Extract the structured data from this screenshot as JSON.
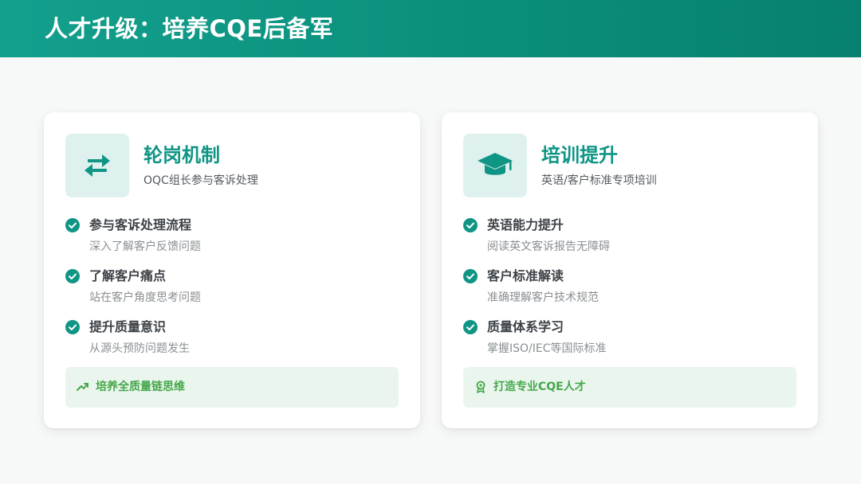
{
  "header": {
    "title": "人才升级：培养CQE后备军"
  },
  "colors": {
    "primary": "#0f9584",
    "icon_bg": "#dff1ee",
    "footer_bg": "#eaf6ed",
    "footer_text": "#45a74b"
  },
  "cards": [
    {
      "icon": "swap-arrows-icon",
      "title": "轮岗机制",
      "subtitle": "OQC组长参与客诉处理",
      "items": [
        {
          "title": "参与客诉处理流程",
          "desc": "深入了解客户反馈问题"
        },
        {
          "title": "了解客户痛点",
          "desc": "站在客户角度思考问题"
        },
        {
          "title": "提升质量意识",
          "desc": "从源头预防问题发生"
        }
      ],
      "footer": {
        "icon": "trending-up-icon",
        "text": "培养全质量链思维"
      }
    },
    {
      "icon": "graduation-cap-icon",
      "title": "培训提升",
      "subtitle": "英语/客户标准专项培训",
      "items": [
        {
          "title": "英语能力提升",
          "desc": "阅读英文客诉报告无障碍"
        },
        {
          "title": "客户标准解读",
          "desc": "准确理解客户技术规范"
        },
        {
          "title": "质量体系学习",
          "desc": "掌握ISO/IEC等国际标准"
        }
      ],
      "footer": {
        "icon": "award-icon",
        "text": "打造专业CQE人才"
      }
    }
  ]
}
